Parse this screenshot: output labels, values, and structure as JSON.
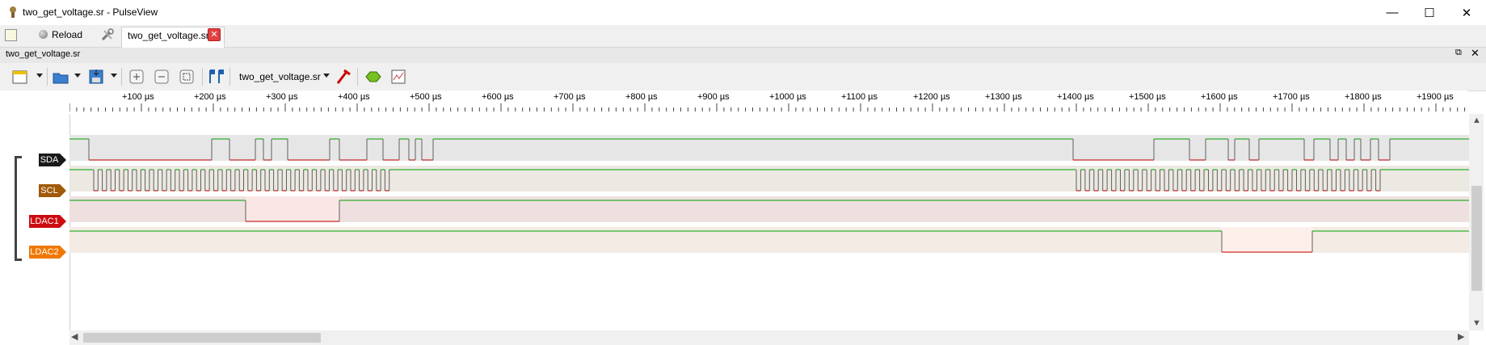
{
  "window": {
    "title": "two_get_voltage.sr - PulseView",
    "minimize": "—",
    "maximize": "☐",
    "close": "✕"
  },
  "tabbar": {
    "reload_label": "Reload",
    "tab_label": "two_get_voltage.sr"
  },
  "document": {
    "title": "two_get_voltage.sr"
  },
  "toolbar": {
    "device_label": "two_get_voltage.sr"
  },
  "ruler": {
    "ticks": [
      "+100 µs",
      "+200 µs",
      "+300 µs",
      "+400 µs",
      "+500 µs",
      "+600 µs",
      "+700 µs",
      "+800 µs",
      "+900 µs",
      "+1000 µs",
      "+1100 µs",
      "+1200 µs",
      "+1300 µs",
      "+1400 µs",
      "+1500 µs",
      "+1600 µs",
      "+1700 µs",
      "+1800 µs",
      "+1900 µs"
    ]
  },
  "channels": [
    {
      "name": "SDA",
      "color": "#1a1a1a"
    },
    {
      "name": "SCL",
      "color": "#a05a0a"
    },
    {
      "name": "LDAC1",
      "color": "#cc0c10"
    },
    {
      "name": "LDAC2",
      "color": "#f07800"
    }
  ],
  "colors": {
    "high_trace": "#00a000",
    "low_trace": "#c00000"
  }
}
